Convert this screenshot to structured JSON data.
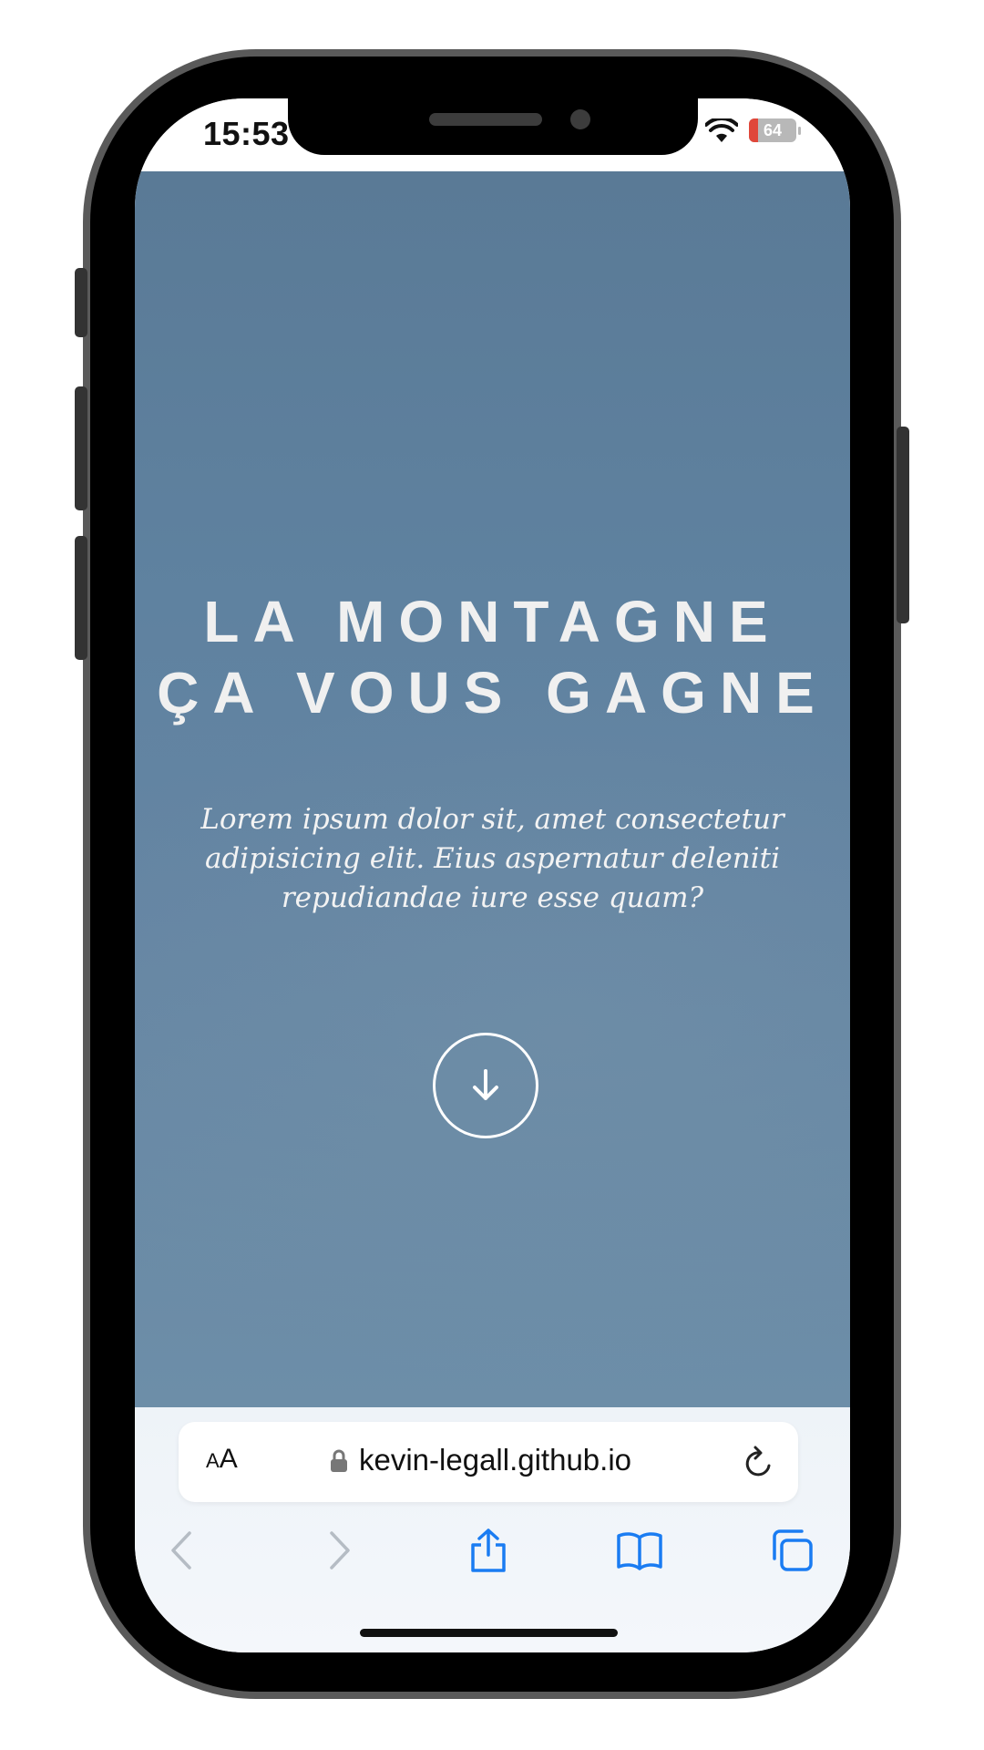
{
  "status_bar": {
    "time": "15:53",
    "battery_level": "64",
    "battery_fraction": 0.2,
    "icons": [
      "wifi-icon",
      "battery-icon"
    ]
  },
  "hero": {
    "title_lines": [
      "LA MONTAGNE",
      "ÇA VOUS GAGNE"
    ],
    "subtitle": "Lorem ipsum dolor sit, amet consectetur adipisicing elit. Eius aspernatur deleniti repudiandae iure esse quam?",
    "scroll_icon": "arrow-down-icon",
    "background_color": "#5f82a0"
  },
  "browser": {
    "text_size_label_small": "A",
    "text_size_label_large": "A",
    "url": "kevin-legall.github.io",
    "icons": [
      "lock-icon",
      "reload-icon",
      "back-icon",
      "forward-icon",
      "share-icon",
      "bookmarks-icon",
      "tabs-icon"
    ],
    "accent_color": "#1a7cf2"
  }
}
